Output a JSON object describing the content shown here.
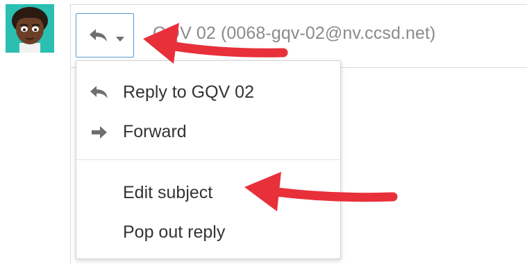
{
  "sender": {
    "avatar_icon": "avatar-cartoon-face"
  },
  "reply_button": {
    "icon": "reply-icon",
    "caret": "chevron-down-icon"
  },
  "recipient": {
    "text": "GQV 02 (0068-gqv-02@nv.ccsd.net)"
  },
  "menu": {
    "items": [
      {
        "label": "Reply to GQV 02",
        "icon": "reply-icon"
      },
      {
        "label": "Forward",
        "icon": "forward-arrow-icon"
      },
      {
        "label": "Edit subject",
        "icon": ""
      },
      {
        "label": "Pop out reply",
        "icon": ""
      }
    ]
  },
  "colors": {
    "annotation_arrow": "#e8303a",
    "button_border": "#5b9bd5",
    "avatar_bg": "#2bbfb1",
    "icon_gray": "#6f6f6f"
  }
}
